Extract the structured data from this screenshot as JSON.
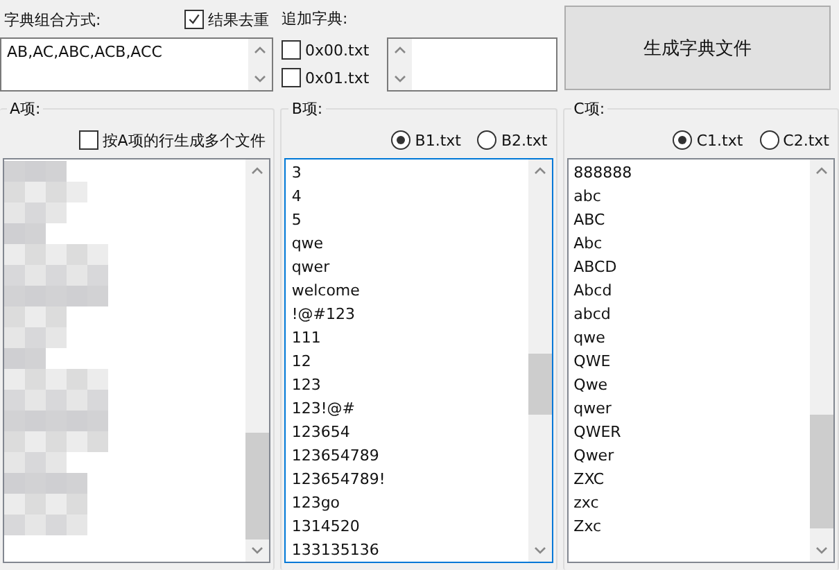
{
  "combination": {
    "label": "字典组合方式:",
    "value": "AB,AC,ABC,ACB,ACC"
  },
  "dedupe": {
    "label": "结果去重",
    "checked": true
  },
  "append": {
    "label": "追加字典:",
    "options": [
      {
        "label": "0x00.txt",
        "checked": false
      },
      {
        "label": "0x01.txt",
        "checked": false
      }
    ]
  },
  "generate_button": "生成字典文件",
  "groups": [
    {
      "title": "A项:",
      "options": [
        {
          "kind": "checkbox",
          "label": "按A项的行生成多个文件",
          "checked": false
        }
      ],
      "pixelated": true,
      "focused": false
    },
    {
      "title": "B项:",
      "options": [
        {
          "kind": "radio",
          "label": "B1.txt",
          "selected": true
        },
        {
          "kind": "radio",
          "label": "B2.txt",
          "selected": false
        }
      ],
      "pixelated": false,
      "focused": true,
      "items": [
        "3",
        "4",
        "5",
        "qwe",
        "qwer",
        "welcome",
        "!@#123",
        "111",
        "12",
        "123",
        "123!@#",
        "123654",
        "123654789",
        "123654789!",
        "123go",
        "1314520",
        "133135136"
      ]
    },
    {
      "title": "C项:",
      "options": [
        {
          "kind": "radio",
          "label": "C1.txt",
          "selected": true
        },
        {
          "kind": "radio",
          "label": "C2.txt",
          "selected": false
        }
      ],
      "pixelated": false,
      "focused": false,
      "items": [
        "888888",
        "abc",
        "ABC",
        "Abc",
        "ABCD",
        "Abcd",
        "abcd",
        "qwe",
        "QWE",
        "Qwe",
        "qwer",
        "QWER",
        "Qwer",
        "ZXC",
        "zxc",
        "Zxc"
      ]
    }
  ]
}
